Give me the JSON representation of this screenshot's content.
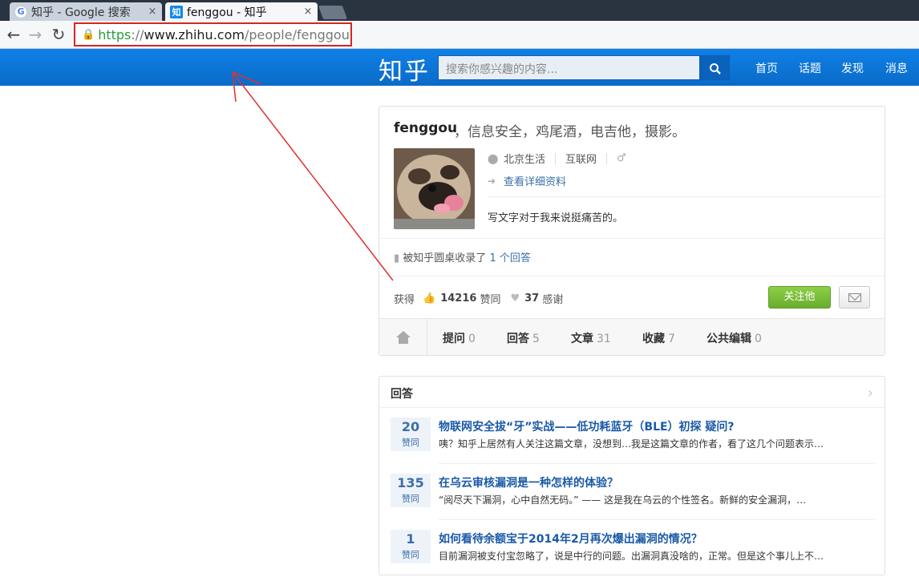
{
  "browser": {
    "tabs": [
      {
        "title": "知乎 - Google 搜索",
        "favicon": "google-favicon",
        "close": "×"
      },
      {
        "title": "fenggou - 知乎",
        "favicon": "zhihu-favicon",
        "close": "×"
      }
    ],
    "url": {
      "scheme": "https",
      "sep": "://",
      "host": "www.zhihu.com",
      "path": "/people/fenggou"
    },
    "lock_icon": "lock-icon",
    "annotation_color": "#d32626"
  },
  "header": {
    "logo": "知乎",
    "search_placeholder": "搜索你感兴趣的内容...",
    "nav": [
      "首页",
      "话题",
      "发现",
      "消息"
    ],
    "brand_color": "#0f74da"
  },
  "profile": {
    "name": "fenggou",
    "bio": "，信息安全，鸡尾酒，电吉他，摄影。",
    "location": "北京生活",
    "industry": "互联网",
    "gender_icon": "male-icon",
    "details_link": "查看详细资料",
    "description": "写文字对于我来说挺痛苦的。",
    "collected_prefix": "被知乎圆桌收录了",
    "collected_link": "1 个回答",
    "stats_prefix": "获得",
    "agree_count": "14216",
    "agree_label": "赞同",
    "thanks_count": "37",
    "thanks_label": "感谢",
    "follow_button": "关注他",
    "tabs": [
      {
        "label": "提问",
        "count": "0"
      },
      {
        "label": "回答",
        "count": "5"
      },
      {
        "label": "文章",
        "count": "31"
      },
      {
        "label": "收藏",
        "count": "7"
      },
      {
        "label": "公共编辑",
        "count": "0"
      }
    ]
  },
  "answers": {
    "heading": "回答",
    "items": [
      {
        "votes": "20",
        "vote_label": "赞同",
        "title": "物联网安全拔“牙”实战——低功耗蓝牙（BLE）初探 疑问?",
        "summary": "咦？知乎上居然有人关注这篇文章，没想到…我是这篇文章的作者，看了这几个问题表示…"
      },
      {
        "votes": "135",
        "vote_label": "赞同",
        "title": "在乌云审核漏洞是一种怎样的体验？",
        "summary": "“阅尽天下漏洞，心中自然无码。” —— 这是我在乌云的个性签名。新鲜的安全漏洞，…"
      },
      {
        "votes": "1",
        "vote_label": "赞同",
        "title": "如何看待余额宝于2014年2月再次爆出漏洞的情况？",
        "summary": "目前漏洞被支付宝忽略了，说是中行的问题。出漏洞真没啥的，正常。但是这个事儿上不…"
      }
    ]
  }
}
